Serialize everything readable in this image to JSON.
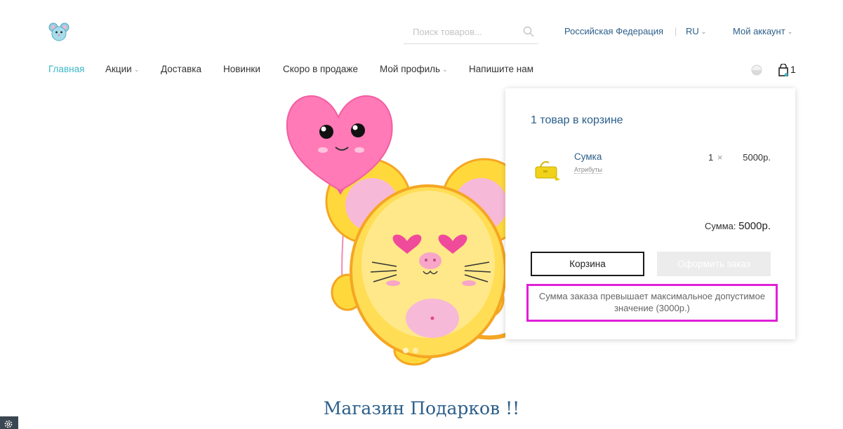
{
  "header": {
    "search_placeholder": "Поиск товаров...",
    "country": "Российская Федерация",
    "separator": "|",
    "language": "RU",
    "account": "Мой аккаунт"
  },
  "nav": {
    "items": [
      {
        "label": "Главная",
        "active": true,
        "has_dropdown": false
      },
      {
        "label": "Акции",
        "active": false,
        "has_dropdown": true
      },
      {
        "label": "Доставка",
        "active": false,
        "has_dropdown": false
      },
      {
        "label": "Новинки",
        "active": false,
        "has_dropdown": false
      },
      {
        "label": "Скоро в продаже",
        "active": false,
        "has_dropdown": false
      },
      {
        "label": "Мой профиль",
        "active": false,
        "has_dropdown": true
      },
      {
        "label": "Напишите нам",
        "active": false,
        "has_dropdown": false
      }
    ],
    "cart_count": "1"
  },
  "cart_popup": {
    "title": "1 товар в корзине",
    "item": {
      "name": "Сумка",
      "attributes_link": "Атрибуты",
      "quantity": "1",
      "times": "×",
      "price": "5000р."
    },
    "sum_label": "Сумма:",
    "sum_value": "5000р.",
    "cart_button": "Корзина",
    "checkout_button": "Оформить заказ",
    "warning": "Сумма заказа превышает максимальное допустимое значение (3000р.)"
  },
  "main": {
    "store_title": "Магазин Подарков !!"
  },
  "colors": {
    "accent": "#3bb8c9",
    "link": "#2c5f8a",
    "warning_border": "#e020d8"
  },
  "icons": [
    "logo-mouse-icon",
    "search-icon",
    "chevron-down-icon",
    "compare-icon",
    "cart-icon",
    "bag-thumbnail-icon",
    "gear-icon"
  ]
}
